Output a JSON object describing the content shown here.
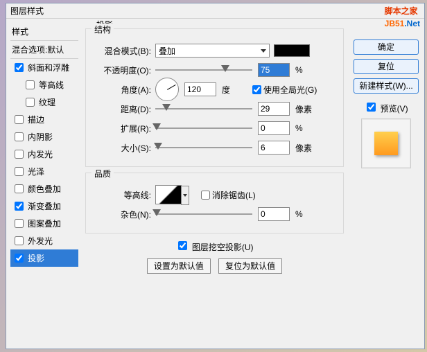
{
  "window": {
    "title": "图层样式"
  },
  "watermark": {
    "part1": "脚本之家",
    "part2": "JB51",
    "part3": ".Net"
  },
  "left": {
    "styles_hdr": "样式",
    "blend_hdr": "混合选项:默认",
    "items": [
      {
        "label": "斜面和浮雕",
        "checked": true
      },
      {
        "label": "等高线",
        "checked": false,
        "sub": true
      },
      {
        "label": "纹理",
        "checked": false,
        "sub": true
      },
      {
        "label": "描边",
        "checked": false
      },
      {
        "label": "内阴影",
        "checked": false
      },
      {
        "label": "内发光",
        "checked": false
      },
      {
        "label": "光泽",
        "checked": false
      },
      {
        "label": "颜色叠加",
        "checked": false
      },
      {
        "label": "渐变叠加",
        "checked": true
      },
      {
        "label": "图案叠加",
        "checked": false
      },
      {
        "label": "外发光",
        "checked": false
      },
      {
        "label": "投影",
        "checked": true,
        "selected": true
      }
    ]
  },
  "mid": {
    "title": "投影",
    "structure": {
      "group": "结构",
      "blendmode_label": "混合模式(B):",
      "blendmode_value": "叠加",
      "opacity_label": "不透明度(O):",
      "opacity_value": "75",
      "opacity_unit": "%",
      "angle_label": "角度(A):",
      "angle_value": "120",
      "angle_unit": "度",
      "global_label": "使用全局光(G)",
      "global_checked": true,
      "distance_label": "距离(D):",
      "distance_value": "29",
      "distance_unit": "像素",
      "spread_label": "扩展(R):",
      "spread_value": "0",
      "spread_unit": "%",
      "size_label": "大小(S):",
      "size_value": "6",
      "size_unit": "像素"
    },
    "quality": {
      "group": "品质",
      "contour_label": "等高线:",
      "antialias_label": "消除锯齿(L)",
      "antialias_checked": false,
      "noise_label": "杂色(N):",
      "noise_value": "0",
      "noise_unit": "%"
    },
    "knockout_label": "图层挖空投影(U)",
    "knockout_checked": true,
    "btn_default": "设置为默认值",
    "btn_reset": "复位为默认值"
  },
  "right": {
    "ok": "确定",
    "cancel": "复位",
    "newstyle": "新建样式(W)...",
    "preview_label": "预览(V)",
    "preview_checked": true
  }
}
